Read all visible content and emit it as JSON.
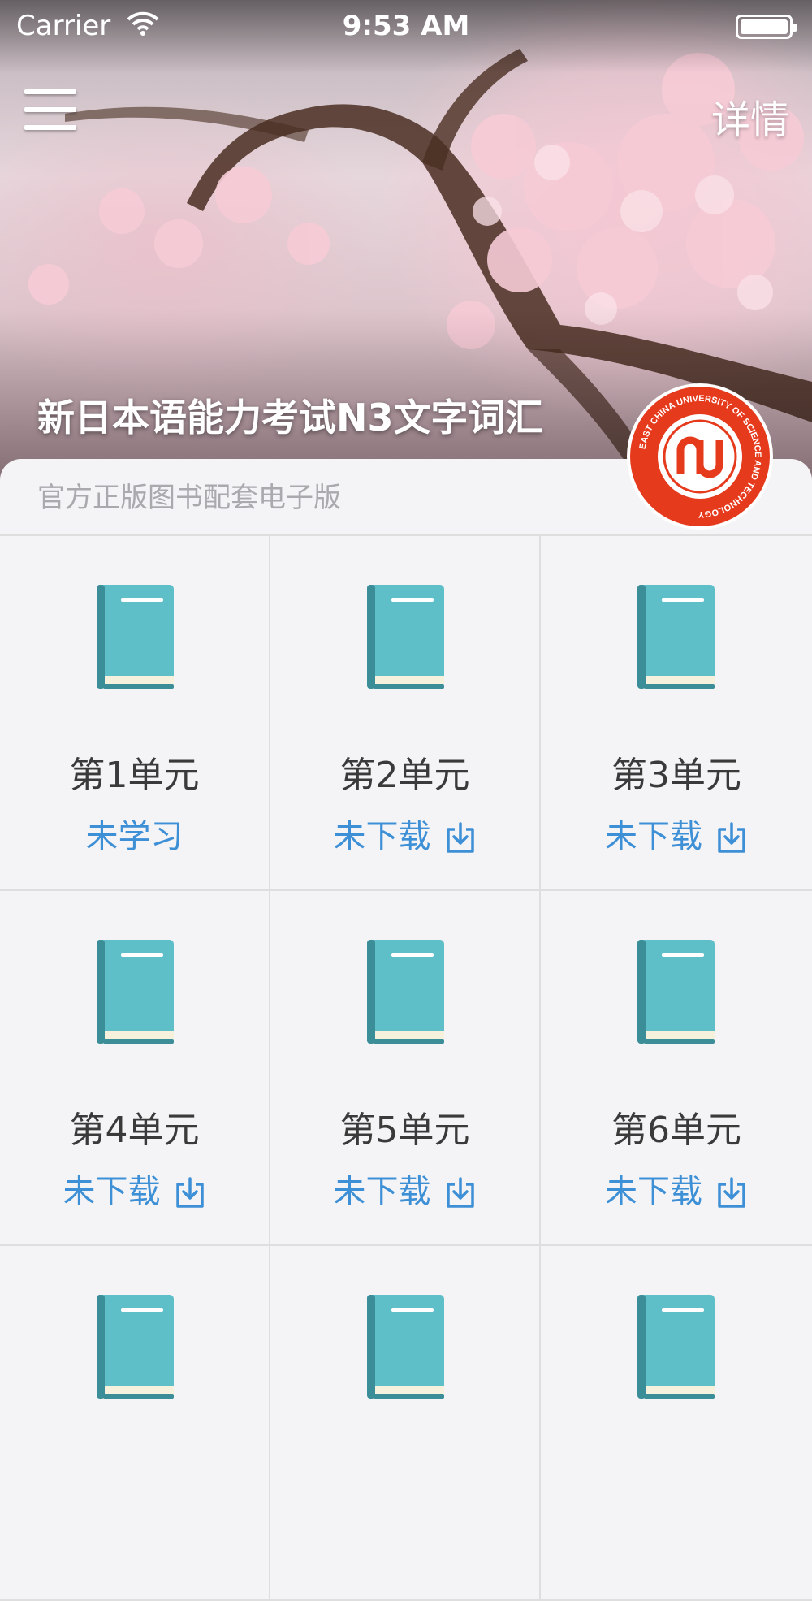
{
  "status_bar": {
    "carrier": "Carrier",
    "time": "9:53 AM"
  },
  "header": {
    "menu_icon": "hamburger-menu-icon",
    "detail_label": "详情",
    "book_title": "新日本语能力考试N3文字词汇",
    "subtitle": "官方正版图书配套电子版",
    "publisher_logo": "east-china-university-of-science-and-technology-logo",
    "logo_text": "EAST CHINA UNIVERSITY OF SCIENCE AND TECHNOLOGY"
  },
  "units": [
    {
      "label": "第1单元",
      "status": "未学习",
      "download_icon": false
    },
    {
      "label": "第2单元",
      "status": "未下载",
      "download_icon": true
    },
    {
      "label": "第3单元",
      "status": "未下载",
      "download_icon": true
    },
    {
      "label": "第4单元",
      "status": "未下载",
      "download_icon": true
    },
    {
      "label": "第5单元",
      "status": "未下载",
      "download_icon": true
    },
    {
      "label": "第6单元",
      "status": "未下载",
      "download_icon": true
    },
    {
      "label": "",
      "status": "",
      "download_icon": false
    },
    {
      "label": "",
      "status": "",
      "download_icon": false
    },
    {
      "label": "",
      "status": "",
      "download_icon": false
    }
  ],
  "colors": {
    "accent": "#3d8fd6",
    "book": "#5fbfc9",
    "book_dark": "#3b8e97",
    "logo_red": "#e63a1d"
  }
}
